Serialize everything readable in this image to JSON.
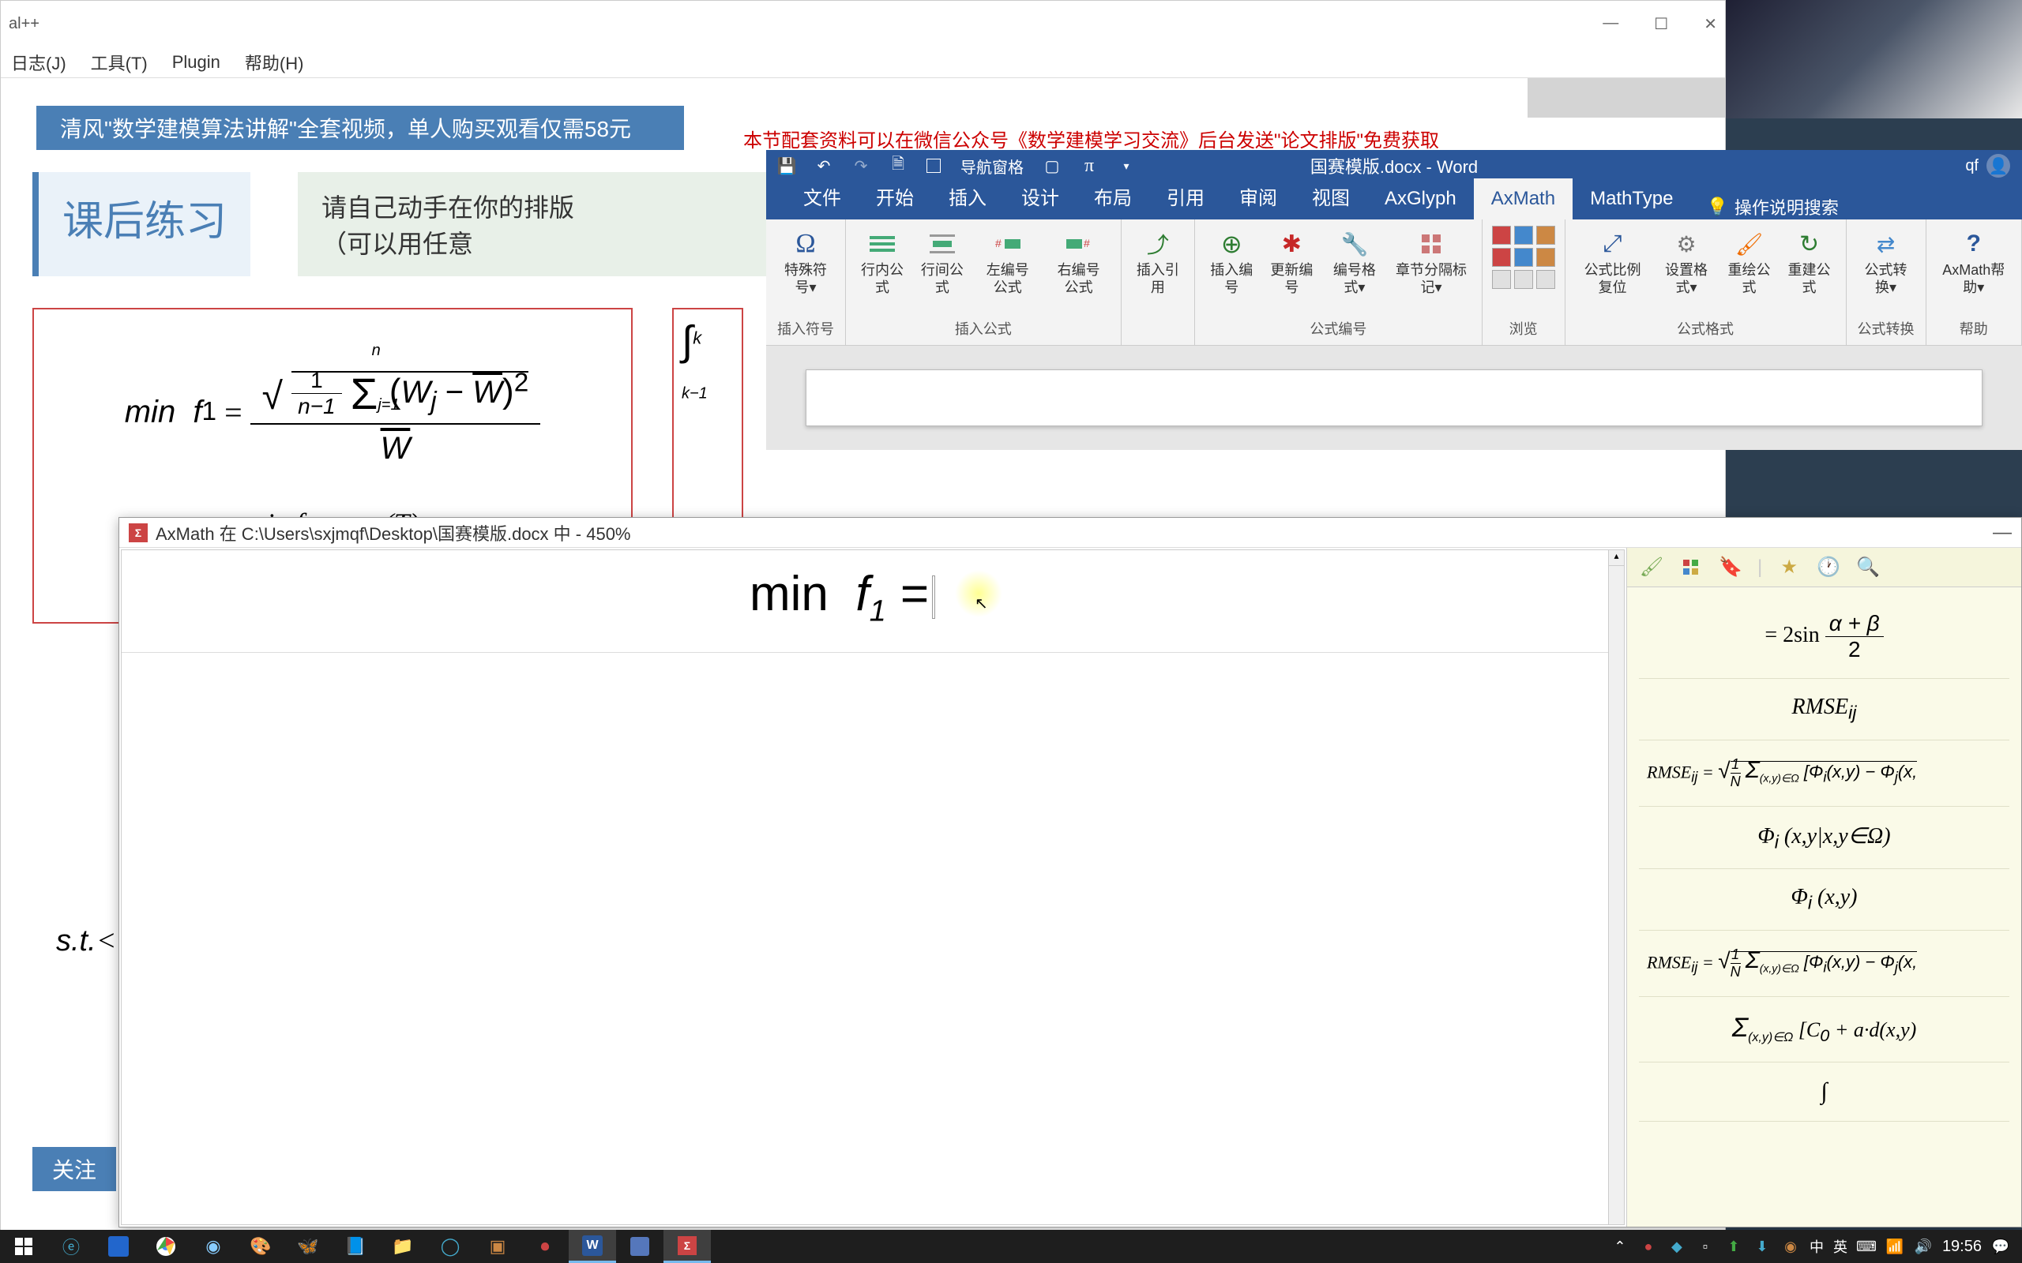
{
  "back_window": {
    "title": "al++",
    "menu": [
      "日志(J)",
      "工具(T)",
      "Plugin",
      "帮助(H)"
    ],
    "blue_banner": "清风\"数学建模算法讲解\"全套视频，单人购买观看仅需58元",
    "red_text": "本节配套资料可以在微信公众号《数学建模学习交流》后台发送\"论文排版\"免费获取",
    "section_title": "课后练习",
    "section_prompt_1": "请自己动手在你的排版",
    "section_prompt_2": "（可以用任意",
    "formula_main": "min f₁ =",
    "formula_sub": "min f = max(T)",
    "st_label": "s.t.",
    "blue_tag": "关注",
    "integral_label": "∫",
    "integral_k": "k",
    "integral_k1": "k−1"
  },
  "word": {
    "doc_title": "国赛模版.docx  -  Word",
    "nav_label": "导航窗格",
    "user": "qf",
    "tabs": [
      "文件",
      "开始",
      "插入",
      "设计",
      "布局",
      "引用",
      "审阅",
      "视图",
      "AxGlyph",
      "AxMath",
      "MathType"
    ],
    "active_tab": "AxMath",
    "search_placeholder": "操作说明搜索",
    "ribbon": {
      "groups": [
        {
          "label": "插入符号",
          "buttons": [
            {
              "label": "特殊符号▾",
              "icon": "Ω"
            }
          ]
        },
        {
          "label": "插入公式",
          "buttons": [
            {
              "label": "行内公式",
              "icon": "≡"
            },
            {
              "label": "行间公式",
              "icon": "≡"
            },
            {
              "label": "左编号公式",
              "icon": "#≡"
            },
            {
              "label": "右编号公式",
              "icon": "≡#"
            }
          ]
        },
        {
          "label": "",
          "buttons": [
            {
              "label": "插入引用",
              "icon": "↗"
            }
          ]
        },
        {
          "label": "公式编号",
          "buttons": [
            {
              "label": "插入编号",
              "icon": "⊕"
            },
            {
              "label": "更新编号",
              "icon": "↻"
            },
            {
              "label": "编号格式▾",
              "icon": "⚙"
            },
            {
              "label": "章节分隔标记▾",
              "icon": "§"
            }
          ]
        },
        {
          "label": "浏览",
          "buttons": []
        },
        {
          "label": "公式格式",
          "buttons": [
            {
              "label": "公式比例复位",
              "icon": "⤢"
            },
            {
              "label": "设置格式▾",
              "icon": "⚙"
            },
            {
              "label": "重绘公式",
              "icon": "🖌"
            },
            {
              "label": "重建公式",
              "icon": "↻"
            }
          ]
        },
        {
          "label": "公式转换",
          "buttons": [
            {
              "label": "公式转换▾",
              "icon": "⇄"
            }
          ]
        },
        {
          "label": "帮助",
          "buttons": [
            {
              "label": "AxMath帮助▾",
              "icon": "?"
            }
          ]
        }
      ]
    }
  },
  "axmath": {
    "title": "AxMath 在 C:\\Users\\sxjmqf\\Desktop\\国赛模版.docx 中 - 450%",
    "equation": "min f₁ =",
    "toolbar_icons": [
      "brush",
      "grid",
      "tag",
      "|",
      "star",
      "clock",
      "search"
    ],
    "history": [
      "= 2sin (α+β)/2",
      "RMSEᵢⱼ",
      "RMSEᵢⱼ = √(1/N Σ(x,y)∈Ω [Φᵢ(x,y) − Φⱼ(x,",
      "Φᵢ(x,y|x,y∈Ω)",
      "Φᵢ(x,y)",
      "RMSEᵢⱼ = √(1/N Σ(x,y)∈Ω [Φᵢ(x,y) − Φⱼ(x,",
      "Σ(x,y)∈Ω [C₀ + a·d(x,y)"
    ]
  },
  "taskbar": {
    "time": "19:56",
    "ime": "英",
    "ime2": "中"
  }
}
